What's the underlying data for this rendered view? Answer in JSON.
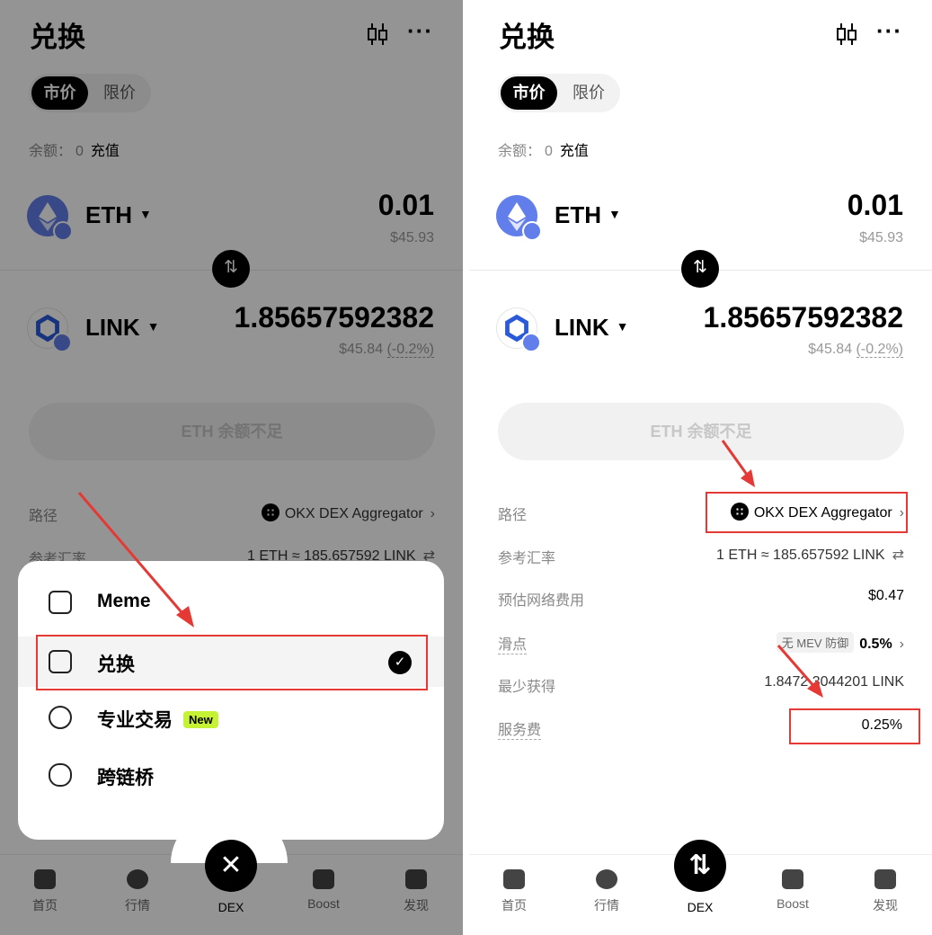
{
  "header": {
    "title": "兑换"
  },
  "segments": {
    "market": "市价",
    "limit": "限价"
  },
  "balance": {
    "label": "余额：",
    "value": "0",
    "deposit": "充值"
  },
  "from_token": {
    "symbol": "ETH",
    "amount": "0.01",
    "usd": "$45.93"
  },
  "to_token": {
    "symbol": "LINK",
    "amount": "1.85657592382",
    "usd": "$45.84",
    "change": "(-0.2%)"
  },
  "cta": {
    "label": "ETH 余额不足"
  },
  "details": {
    "route_label": "路径",
    "route_value": "OKX DEX Aggregator",
    "rate_label": "参考汇率",
    "rate_value": "1 ETH ≈ 185.657592 LINK",
    "fee_label": "预估网络费用",
    "fee_value": "$0.47",
    "slippage_label": "滑点",
    "slippage_tag": "无 MEV 防御",
    "slippage_value": "0.5%",
    "min_label": "最少获得",
    "min_value": "1.8472 3044201 LINK",
    "service_label": "服务费",
    "service_value": "0.25%"
  },
  "menu": {
    "items": [
      {
        "label": "Meme"
      },
      {
        "label": "兑换"
      },
      {
        "label": "专业交易",
        "tag": "New"
      },
      {
        "label": "跨链桥"
      }
    ]
  },
  "tabbar": {
    "home": "首页",
    "market": "行情",
    "dex": "DEX",
    "boost": "Boost",
    "discover": "发现"
  },
  "colors": {
    "annotation_red": "#e53935",
    "new_tag": "#c6f235",
    "eth_blue": "#627eea"
  }
}
